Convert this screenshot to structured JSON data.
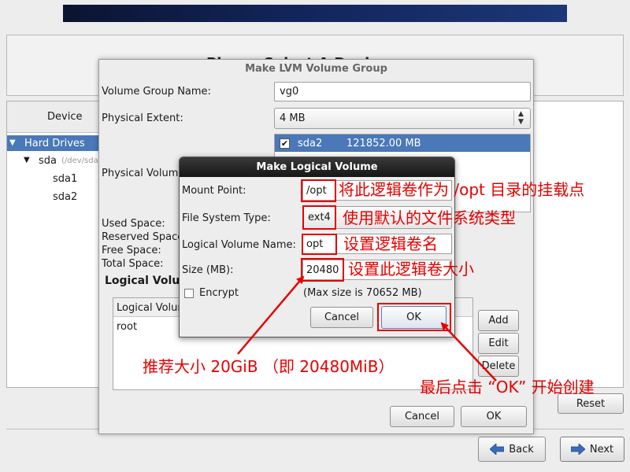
{
  "background": {
    "title_partial": "Please Select A Device",
    "device_header": "Device",
    "tree": {
      "hard_drives": "Hard Drives",
      "sda": "sda",
      "sda_path": "(/dev/sda)",
      "sda1": "sda1",
      "sda2": "sda2"
    },
    "reset_label": "Reset",
    "back_label": "Back",
    "next_label": "Next"
  },
  "lvm_dialog": {
    "title": "Make LVM Volume Group",
    "vg_name_label": "Volume Group Name:",
    "vg_name_value": "vg0",
    "pe_label": "Physical Extent:",
    "pe_value": "4 MB",
    "pv_label": "Physical Volumes to Use:",
    "pv_name": "sda2",
    "pv_size": "121852.00 MB",
    "used_space": "Used Space:",
    "reserved_space": "Reserved Space:",
    "free_space": "Free Space:",
    "total_space": "Total Space:",
    "lv_section": "Logical Volumes",
    "lv_column": "Logical Volume Name",
    "lv_rows": [
      "root"
    ],
    "add_label": "Add",
    "edit_label": "Edit",
    "delete_label": "Delete",
    "cancel_label": "Cancel",
    "ok_label": "OK"
  },
  "lv_dialog": {
    "title": "Make Logical Volume",
    "mount_point_label": "Mount Point:",
    "mount_point_value": "/opt",
    "fs_type_label": "File System Type:",
    "fs_type_value": "ext4",
    "lv_name_label": "Logical Volume Name:",
    "lv_name_value": "opt",
    "size_label": "Size (MB):",
    "size_value": "20480",
    "encrypt_label": "Encrypt",
    "encrypt_checked": false,
    "max_size": "(Max size is 70652 MB)",
    "cancel_label": "Cancel",
    "ok_label": "OK"
  },
  "annotations": {
    "mount_point": "将此逻辑卷作为 /opt 目录的挂载点",
    "fs_type": "使用默认的文件系统类型",
    "lv_name": "设置逻辑卷名",
    "size": "设置此逻辑卷大小",
    "recommend": "推荐大小 20GiB （即 20480MiB）",
    "ok_hint": "最后点击 “OK” 开始创建",
    "color": "#e60000"
  },
  "colors": {
    "selection": "#4a78b8",
    "banner": "#12245a",
    "titlebar": "#161616"
  }
}
